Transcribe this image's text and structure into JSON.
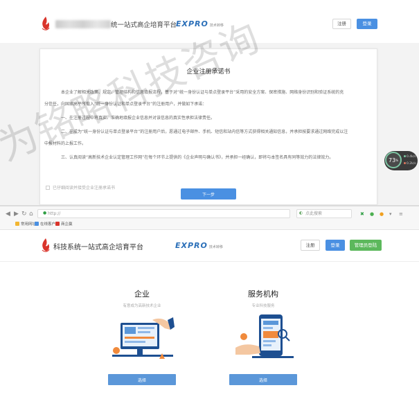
{
  "top": {
    "site_title": "统一站式高企培育平台",
    "brand": "EXPRO",
    "brand_sub": "技术转移",
    "register": "注册",
    "login": "登录",
    "card_title": "企业注册承诺书",
    "paragraphs": [
      "本企业了解相关政策、规定、管理结构和信息填报流程，基于对“统一身份认证与单点登录平台”采用的安全方案、保密措施、网络身份识别和验证系统的充",
      "分信任，向国家高平所载入“统一身份认证和单点登录平台”的注册用户，并做如下承诺：",
      "一、在注册过程中将真实、准确地填报企业信息并对该信息的真实性承担法律责任。",
      "二、在成为“统一身份认证与单点登录平台”的注册用户后，愿通过电子邮件、手机、短信和站内信等方式获得相关通知信息，并承担按要求通过网络完成以注",
      "中报材料的上报工作。",
      "三、认真阅读“高新技术企业认定管理工作网”在每个环节上提供的《企业声明与确认书》，并承担一经确认，即将与本签名具有同等效力的法律效力。"
    ],
    "agree_label": "已仔细阅读并接受企业注册承诺书",
    "next_button": "下一步",
    "gauge": {
      "value": "73",
      "unit": "%",
      "stat_up": "0.4k/s",
      "stat_down": "0.2k/s"
    }
  },
  "browser": {
    "address": "http://",
    "search_placeholder": "点此搜索",
    "bookmarks": [
      "常用网址",
      "在线客户",
      "商企赢"
    ]
  },
  "bottom": {
    "site_title": "科技系统一站式高企培育平台",
    "brand": "EXPRO",
    "brand_sub": "技术转移",
    "register": "注册",
    "login": "登录",
    "admin_login": "管理员登陆",
    "options": [
      {
        "title": "企业",
        "subtitle": "有意成为高新技术企业",
        "button": "选择"
      },
      {
        "title": "服务机构",
        "subtitle": "专业科技服务",
        "button": "选择"
      }
    ]
  },
  "watermark": "智为铭略科技咨询",
  "colors": {
    "accent": "#4a90e2",
    "green": "#5cb85c",
    "brand": "#2b6fb8"
  },
  "icons": [
    "flame-logo-icon",
    "back-arrow-icon",
    "forward-arrow-icon",
    "refresh-icon",
    "home-icon",
    "lock-icon",
    "search-icon",
    "extension-icon"
  ]
}
